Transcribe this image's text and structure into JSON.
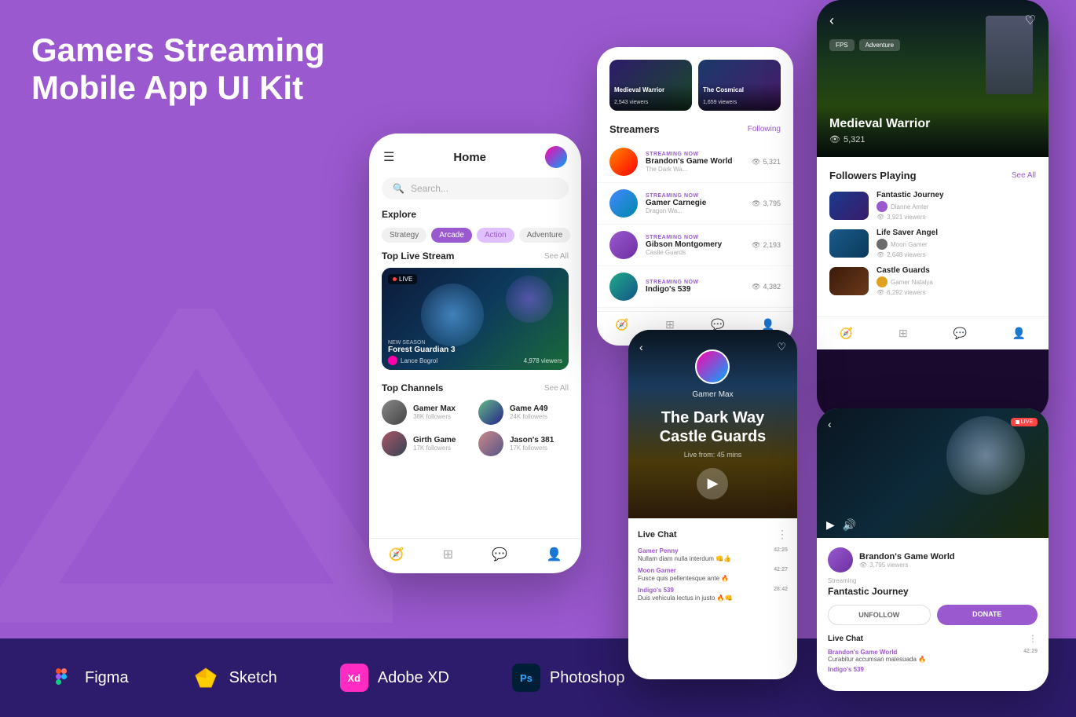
{
  "hero": {
    "title_line1": "Gamers Streaming",
    "title_line2": "Mobile App UI Kit"
  },
  "tools": [
    {
      "name": "Figma",
      "icon": "figma"
    },
    {
      "name": "Sketch",
      "icon": "sketch"
    },
    {
      "name": "Adobe XD",
      "icon": "xd"
    },
    {
      "name": "Photoshop",
      "icon": "ps"
    }
  ],
  "phone1": {
    "header_title": "Home",
    "search_placeholder": "Search...",
    "explore_label": "Explore",
    "genres": [
      "Strategy",
      "Arcade",
      "Action",
      "Adventure"
    ],
    "active_genre": "Arcade",
    "top_live_stream_label": "Top Live Stream",
    "see_all": "See All",
    "live_badge": "LIVE",
    "stream": {
      "season": "NEW SEASON",
      "name": "Forest Guardian 3",
      "host": "Lance Bogrol",
      "viewers": "4,978 viewers"
    },
    "top_channels_label": "Top Channels",
    "channels": [
      {
        "name": "Gamer Max",
        "followers": "38K followers"
      },
      {
        "name": "Game A49",
        "followers": "24K followers"
      },
      {
        "name": "Girth Game",
        "followers": "17K followers"
      },
      {
        "name": "Jason's 381",
        "followers": "17K followers"
      }
    ]
  },
  "phone2": {
    "thumbnails": [
      {
        "game": "Medieval Warrior",
        "viewers": "2,543 viewers"
      },
      {
        "game": "The Cosmical",
        "viewers": "1,659 viewers"
      }
    ],
    "streamers_label": "Streamers",
    "following_label": "Following",
    "streamers": [
      {
        "name": "Brandon's Game World",
        "game": "The Dark Wa...",
        "viewers": "5,321",
        "status": "STREAMING NOW"
      },
      {
        "name": "Gamer Carnegie",
        "game": "Dragon Wa...",
        "viewers": "3,795",
        "status": "STREAMING NOW"
      },
      {
        "name": "Gibson Montgomery",
        "game": "Castle Guards",
        "viewers": "2,193",
        "status": "STREAMING NOW"
      },
      {
        "name": "Indigo's 539",
        "game": "",
        "viewers": "4,382",
        "status": "STREAMING NOW"
      }
    ]
  },
  "phone3": {
    "game_title": "Medieval Warrior",
    "viewers": "5,321",
    "genres": [
      "FPS",
      "Adventure"
    ],
    "followers_playing": "Followers Playing",
    "see_all": "See All",
    "games": [
      {
        "name": "Fantastic Journey",
        "host": "Dianne Amter",
        "viewers": "3,921 viewers"
      },
      {
        "name": "Life Saver Angel",
        "host": "Moon Gamer",
        "viewers": "2,648 viewers"
      },
      {
        "name": "Castle Guards",
        "host": "Gamer Natalya",
        "viewers": "6,292 viewers"
      }
    ]
  },
  "phone4": {
    "gamer": "Gamer Max",
    "game_title_line1": "The Dark Way",
    "game_title_line2": "Castle Guards",
    "live_from": "Live from: 45 mins",
    "chat_title": "Live Chat",
    "messages": [
      {
        "user": "Gamer Penny",
        "time": "42:25",
        "text": "Nullam diam nulla interdum 👊👍"
      },
      {
        "user": "Moon Gamer",
        "time": "42:27",
        "text": "Fusce quis pellentesque ante 🔥"
      },
      {
        "user": "Indigo's 539",
        "time": "28:42",
        "text": "Duis vehicula lectus in justo 🔥👊"
      }
    ]
  },
  "phone5": {
    "live_badge": "LIVE",
    "channel_name": "Brandon's Game World",
    "viewers": "3,795 viewers",
    "streaming_label": "Streaming",
    "game_name": "Fantastic Journey",
    "unfollow_label": "UNFOLLOW",
    "donate_label": "DONATE",
    "chat_title": "Live Chat",
    "messages": [
      {
        "user": "Brandon's Game World",
        "time": "42:29",
        "text": "Curabitur accumsan malesuada 🔥"
      },
      {
        "user": "Indigo's 539",
        "time": "",
        "text": ""
      }
    ]
  },
  "colors": {
    "purple": "#9b59d0",
    "dark_purple": "#2d1b6b",
    "accent": "#9b59d0"
  }
}
